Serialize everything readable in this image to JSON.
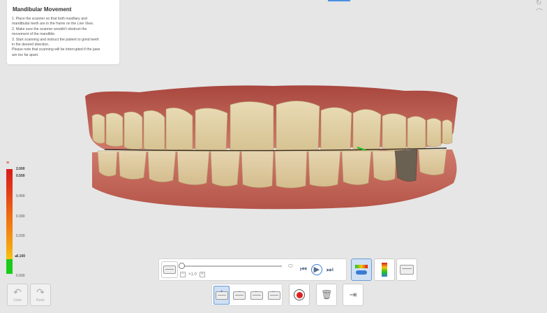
{
  "panel": {
    "title": "Mandibular Movement",
    "lines": [
      "1. Place the scanner so that both maxillary and",
      "mandibular teeth are in the frame on the Live View.",
      "2. Make sure the scanner wouldn't obstruct the",
      "movement of the mandible.",
      "3. Start scanning and instruct the patient to grind teeth",
      "in the desired direction.",
      "Please note that scanning will be interrupted if the jaws",
      "are too far apart."
    ]
  },
  "scale": {
    "labels": [
      "2.000",
      "0.500",
      "0.400",
      "0.300",
      "0.200",
      "0.100",
      "0.000"
    ],
    "highlight_min": "0.100",
    "colors": {
      "high": "#d71b1b",
      "mid": "#ee6d12",
      "low": "#f7c30f",
      "ok": "#1ec51e"
    }
  },
  "history": {
    "undo_label": "Undo",
    "redo_label": "Redo"
  },
  "player": {
    "speed_label": "×1.0",
    "progress": 0.0
  },
  "toolbar": {
    "active_scan_mode": "tmj-both"
  },
  "accent_color": "#3a7bd5"
}
